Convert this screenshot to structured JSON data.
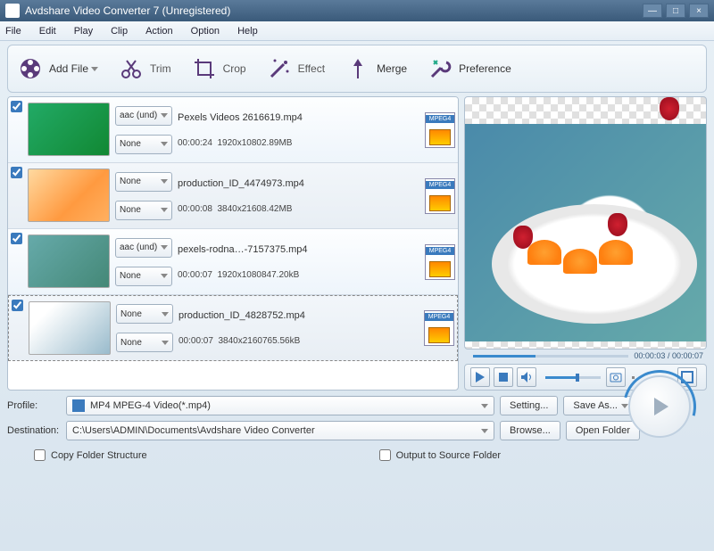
{
  "window": {
    "title": "Avdshare Video Converter 7 (Unregistered)"
  },
  "menu": [
    "File",
    "Edit",
    "Play",
    "Clip",
    "Action",
    "Option",
    "Help"
  ],
  "toolbar": {
    "addfile": "Add File",
    "trim": "Trim",
    "crop": "Crop",
    "effect": "Effect",
    "merge": "Merge",
    "preference": "Preference"
  },
  "files": [
    {
      "checked": true,
      "audio": "aac (und)",
      "subtitle": "None",
      "name": "Pexels Videos 2616619.mp4",
      "duration": "00:00:24",
      "res": "1920x1080",
      "size": "2.89MB",
      "fmt": "MPEG4"
    },
    {
      "checked": true,
      "audio": "None",
      "subtitle": "None",
      "name": "production_ID_4474973.mp4",
      "duration": "00:00:08",
      "res": "3840x2160",
      "size": "8.42MB",
      "fmt": "MPEG4"
    },
    {
      "checked": true,
      "audio": "aac (und)",
      "subtitle": "None",
      "name": "pexels-rodna…-7157375.mp4",
      "duration": "00:00:07",
      "res": "1920x1080",
      "size": "847.20kB",
      "fmt": "MPEG4"
    },
    {
      "checked": true,
      "audio": "None",
      "subtitle": "None",
      "name": "production_ID_4828752.mp4",
      "duration": "00:00:07",
      "res": "3840x2160",
      "size": "765.56kB",
      "fmt": "MPEG4"
    }
  ],
  "preview": {
    "current": "00:00:03",
    "total": "00:00:07"
  },
  "profile": {
    "label": "Profile:",
    "value": "MP4 MPEG-4 Video(*.mp4)",
    "setting": "Setting...",
    "saveas": "Save As..."
  },
  "destination": {
    "label": "Destination:",
    "value": "C:\\Users\\ADMIN\\Documents\\Avdshare Video Converter",
    "browse": "Browse...",
    "open": "Open Folder"
  },
  "checks": {
    "copyfolder": "Copy Folder Structure",
    "outputsource": "Output to Source Folder"
  }
}
